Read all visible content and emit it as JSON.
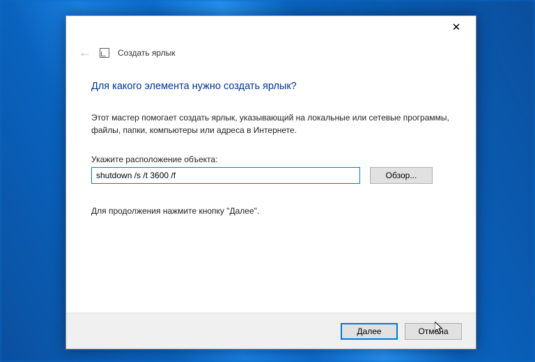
{
  "header": {
    "wizard_title": "Создать ярлык"
  },
  "main": {
    "question": "Для какого элемента нужно создать ярлык?",
    "description": "Этот мастер помогает создать ярлык, указывающий на локальные или сетевые программы, файлы, папки, компьютеры или адреса в Интернете.",
    "location_label": "Укажите расположение объекта:",
    "location_value": "shutdown /s /t 3600 /f",
    "browse_label": "Обзор...",
    "continue_hint": "Для продолжения нажмите кнопку \"Далее\"."
  },
  "footer": {
    "next_label": "Далее",
    "cancel_label": "Отмена"
  }
}
